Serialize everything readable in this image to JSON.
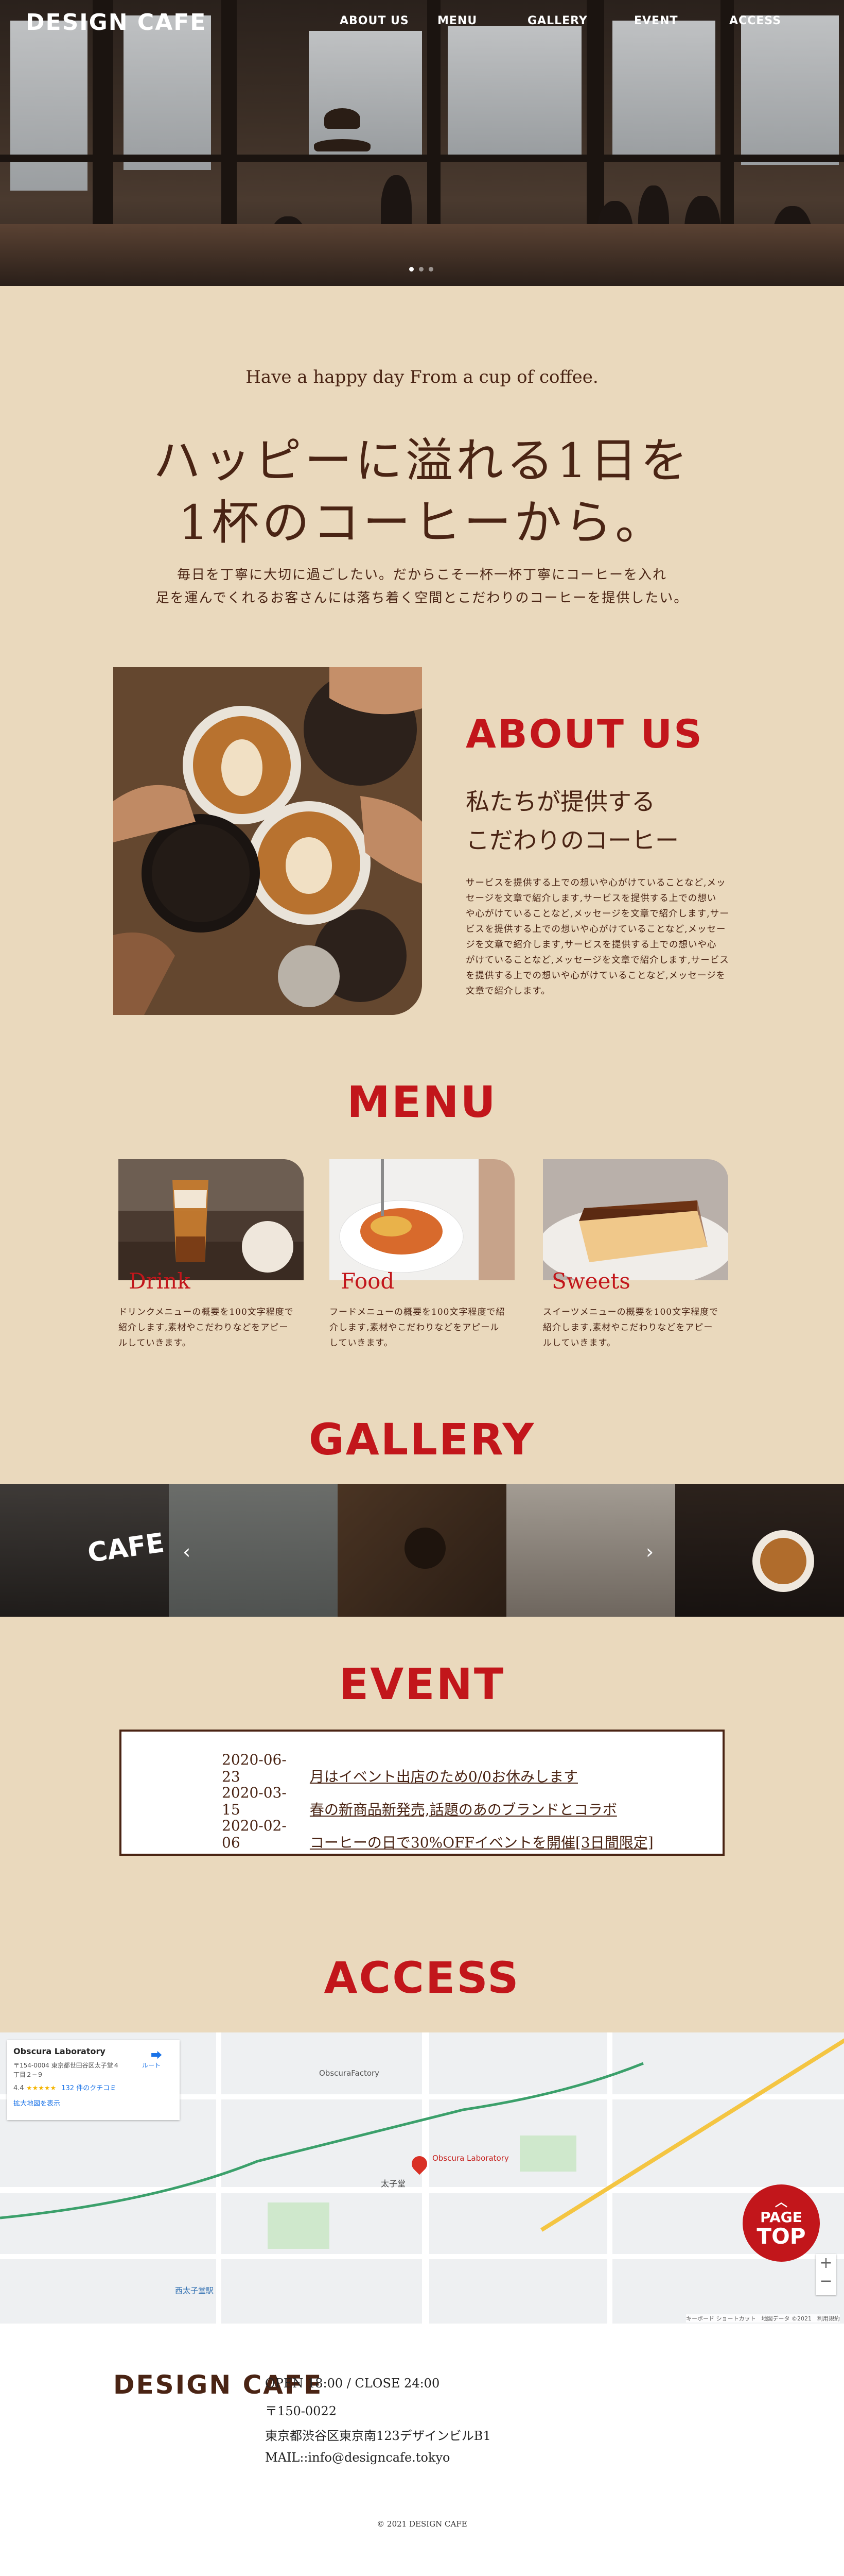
{
  "header": {
    "logo": "DESIGN CAFE",
    "nav": [
      "ABOUT US",
      "MENU",
      "GALLERY",
      "EVENT",
      "ACCESS"
    ]
  },
  "intro": {
    "tagline": "Have a happy day From a cup of coffee.",
    "headline_line1": "ハッピーに溢れる1日を",
    "headline_line2": "1杯のコーヒーから。",
    "body_line1": "毎日を丁寧に大切に過ごしたい。だからこそ一杯一杯丁寧にコーヒーを入れ",
    "body_line2": "足を運んでくれるお客さんには落ち着く空間とこだわりのコーヒーを提供したい。"
  },
  "about": {
    "heading": "ABOUT US",
    "subheading_line1": "私たちが提供する",
    "subheading_line2": "こだわりのコーヒー",
    "body_lines": [
      "サービスを提供する上での想いや心がけていることなど,メッ",
      "セージを文章で紹介します,サービスを提供する上での想い",
      "や心がけていることなど,メッセージを文章で紹介します,サー",
      "ビスを提供する上での想いや心がけていることなど,メッセー",
      "ジを文章で紹介します,サービスを提供する上での想いや心",
      "がけていることなど,メッセージを文章で紹介します,サービス",
      "を提供する上での想いや心がけていることなど,メッセージを",
      "文章で紹介します。"
    ]
  },
  "menu": {
    "heading": "MENU",
    "items": [
      {
        "title": "Drink",
        "desc": [
          "ドリンクメニューの概要を100文字程度で",
          "紹介します,素材やこだわりなどをアピー",
          "ルしていきます。"
        ]
      },
      {
        "title": "Food",
        "desc": [
          "フードメニューの概要を100文字程度で紹",
          "介します,素材やこだわりなどをアピール",
          "していきます。"
        ]
      },
      {
        "title": "Sweets",
        "desc": [
          "スイーツメニューの概要を100文字程度で",
          "紹介します,素材やこだわりなどをアピー",
          "ルしていきます。"
        ]
      }
    ]
  },
  "gallery": {
    "heading": "GALLERY",
    "sign_text": "CAFE",
    "prev": "‹",
    "next": "›"
  },
  "event": {
    "heading": "EVENT",
    "items": [
      {
        "date": "2020-06-23",
        "text": "月はイベント出店のため0/0お休みします"
      },
      {
        "date": "2020-03-15",
        "text": "春の新商品新発売,話題のあのブランドとコラボ"
      },
      {
        "date": "2020-02-06",
        "text": "コーヒーの日で30%OFFイベントを開催[3日間限定]"
      }
    ]
  },
  "access": {
    "heading": "ACCESS",
    "map_card": {
      "name": "Obscura Laboratory",
      "address_line1": "〒154-0004 東京都世田谷区太子堂４",
      "address_line2": "丁目２−９",
      "rating": "4.4",
      "stars": "★★★★★",
      "reviews": "132 件のクチコミ",
      "enlarge": "拡大地図を表示",
      "route": "ルート"
    },
    "map_labels": {
      "place": "Obscura Laboratory",
      "factory": "ObscuraFactory",
      "area": "太子堂",
      "station": "西太子堂駅",
      "footer": "キーボード ショートカット　地図データ ©2021　利用規約"
    },
    "zoom_in": "+",
    "zoom_out": "−",
    "pagetop_line1": "PAGE",
    "pagetop_line2": "TOP"
  },
  "footer": {
    "logo": "DESIGN CAFE",
    "hours": "OPEN 18:00 / CLOSE 24:00",
    "zip": "〒150-0022",
    "address": "東京都渋谷区東京南123デザインビルB1",
    "mail": "MAIL::info@designcafe.tokyo",
    "copyright": "© 2021 DESIGN CAFE"
  },
  "colors": {
    "background": "#ead9bd",
    "accent_red": "#c2161b",
    "text_brown": "#4a2414"
  }
}
